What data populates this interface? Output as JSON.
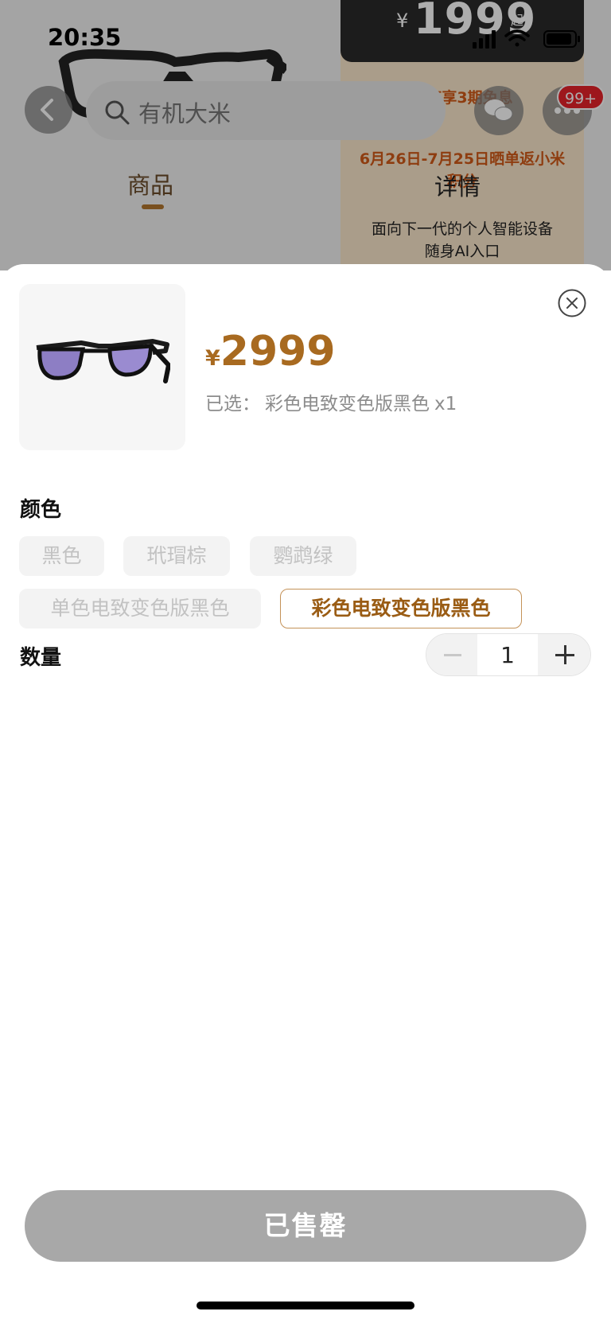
{
  "status_bar": {
    "time": "20:35"
  },
  "background_page": {
    "search_placeholder": "有机大米",
    "badge_count": "99+",
    "tabs": [
      {
        "label": "商品"
      },
      {
        "label": "详情"
      }
    ],
    "promo": {
      "currency": "¥",
      "price": "1999",
      "price_suffix": "起",
      "line1": "至高享3期免息",
      "line2": "6月26日-7月25日晒单返小米积分",
      "slogan_line1": "面向下一代的个人智能设备",
      "slogan_line2": "随身AI入口"
    }
  },
  "sheet": {
    "price_currency": "¥",
    "price": "2999",
    "selected_label": "已选：",
    "selected_value": "彩色电致变色版黑色",
    "selected_qty": "x1",
    "color_title": "颜色",
    "color_options": [
      {
        "label": "黑色",
        "state": "disabled"
      },
      {
        "label": "玳瑁棕",
        "state": "disabled"
      },
      {
        "label": "鹦鹉绿",
        "state": "disabled"
      },
      {
        "label": "单色电致变色版黑色",
        "state": "disabled"
      },
      {
        "label": "彩色电致变色版黑色",
        "state": "selected"
      }
    ],
    "quantity_title": "数量",
    "quantity": "1",
    "action_button": "已售罄"
  },
  "colors": {
    "accent_gold": "#a86a20",
    "disabled_button": "#a8a8a8",
    "badge_red": "#e8222a"
  },
  "icons": [
    "back-icon",
    "search-icon",
    "wechat-icon",
    "more-icon",
    "close-icon",
    "signal-icon",
    "wifi-icon",
    "battery-icon"
  ]
}
